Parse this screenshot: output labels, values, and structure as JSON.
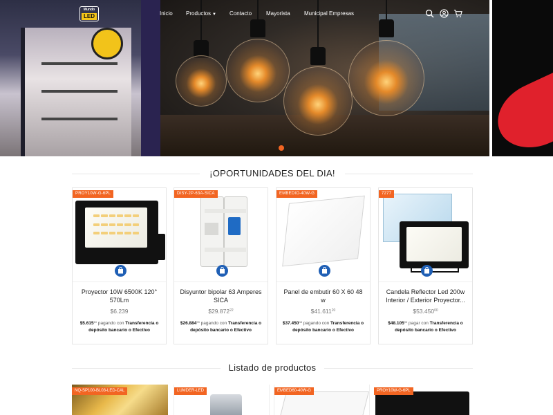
{
  "brand": {
    "logo_top": "Mundo",
    "logo_bottom": "LED"
  },
  "nav": {
    "items": [
      {
        "label": "Inicio"
      },
      {
        "label": "Productos",
        "has_dropdown": true
      },
      {
        "label": "Contacto"
      },
      {
        "label": "Mayorista"
      },
      {
        "label": "Municipal Empresas"
      }
    ],
    "icons": [
      "search-icon",
      "user-icon",
      "cart-icon"
    ]
  },
  "hero": {
    "active_slide": 2,
    "accent_color": "#f26522"
  },
  "sections": {
    "deals_title": "¡OPORTUNIDADES DEL DIA!",
    "list_title": "Listado de productos"
  },
  "deals": [
    {
      "sku": "PROY10W-G-6PL",
      "name": "Proyector 10W 6500K 120° 570Lm",
      "price": "$6.239",
      "promo_price": "$5.615",
      "promo_price_cents": "10",
      "promo_text": "pagando con",
      "promo_method": "Transferencia o depósito bancario o Efectivo"
    },
    {
      "sku": "DISY-2P-63A-SICA",
      "name": "Disyuntor bipolar 63 Amperes SICA",
      "price": "$29.872",
      "price_cents": "22",
      "promo_price": "$26.884",
      "promo_price_cents": "99",
      "promo_text": "pagando con",
      "promo_method": "Transferencia o depósito bancario o Efectivo"
    },
    {
      "sku": "EMBEDIO-40W-G",
      "name": "Panel de embutir 60 X 60 48 w",
      "price": "$41.611",
      "price_cents": "20",
      "promo_price": "$37.450",
      "promo_price_cents": "08",
      "promo_text": "pagando con",
      "promo_method": "Transferencia o depósito bancario o Efectivo"
    },
    {
      "sku": "7277",
      "name": "Candela Reflector Led 200w Interior / Exterior Proyector...",
      "price": "$53.450",
      "price_cents": "00",
      "promo_price": "$48.105",
      "promo_price_cents": "00",
      "promo_text": "pagar con",
      "promo_method": "Transferencia o depósito bancario o Efectivo"
    }
  ],
  "list_products": [
    {
      "sku": "NQ-SP100-BL03-LED-CAL"
    },
    {
      "sku": "LUMDER-LED"
    },
    {
      "sku": "EMBED60-40W-G"
    },
    {
      "sku": "PROY10W-G-6PL"
    }
  ]
}
